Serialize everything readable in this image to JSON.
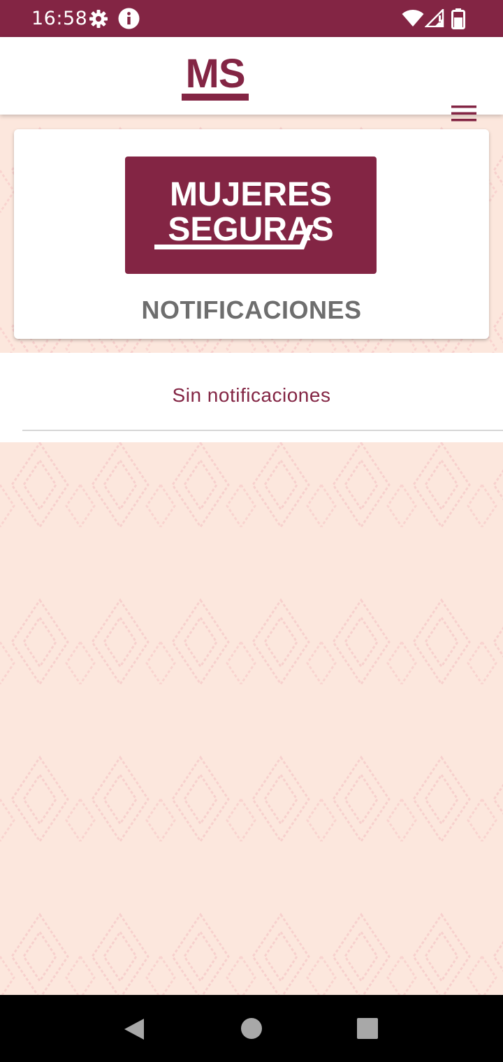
{
  "status_bar": {
    "time": "16:58",
    "icons": [
      "settings-icon",
      "info-icon",
      "wifi-icon",
      "signal-icon",
      "battery-icon"
    ]
  },
  "app_bar": {
    "logo_text": "MS",
    "menu_icon": "hamburger-menu-icon"
  },
  "header_card": {
    "logo_line1": "MUJERES",
    "logo_line2": "SEGURAS",
    "title": "NOTIFICACIONES"
  },
  "notifications": {
    "empty_text": "Sin notificaciones"
  },
  "nav_bar": {
    "buttons": [
      "back-icon",
      "home-icon",
      "recents-icon"
    ]
  },
  "colors": {
    "brand": "#832544",
    "background_pattern": "#fce7dd",
    "title_gray": "#6e6e6e"
  }
}
